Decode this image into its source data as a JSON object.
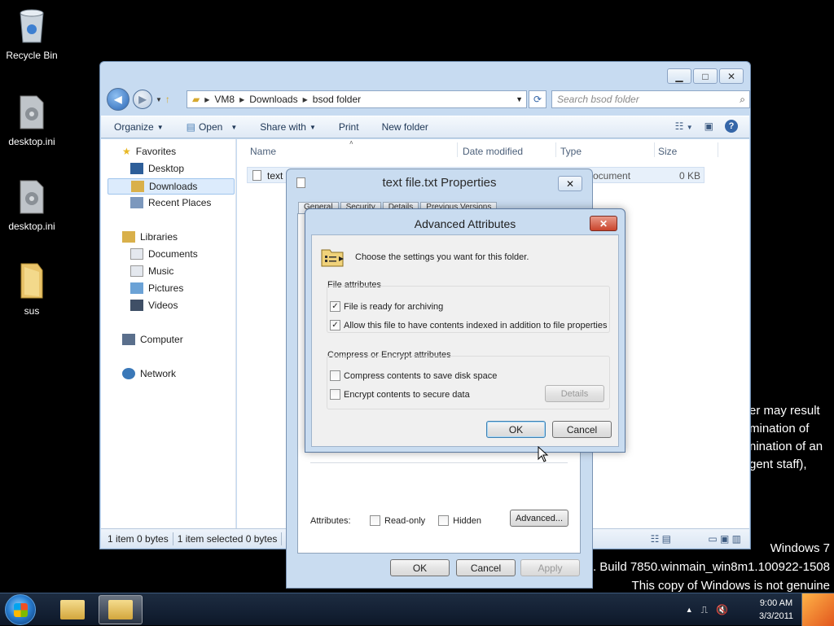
{
  "desktop": {
    "icons": [
      {
        "label": "Recycle Bin"
      },
      {
        "label": "desktop.ini"
      },
      {
        "label": "desktop.ini"
      },
      {
        "label": "sus"
      }
    ],
    "bg_text": [
      "er may result",
      "mination of",
      "nination of an",
      "gent staff),"
    ],
    "watermark": {
      "line1": "Windows 7",
      "line2": ". Build 7850.winmain_win8m1.100922-1508",
      "line3": "This copy of Windows is not genuine"
    }
  },
  "explorer": {
    "breadcrumb": [
      "VM8",
      "Downloads",
      "bsod folder"
    ],
    "search_placeholder": "Search bsod folder",
    "toolbar": {
      "organize": "Organize",
      "open": "Open",
      "share_with": "Share with",
      "print": "Print",
      "new_folder": "New folder"
    },
    "nav": {
      "favorites": "Favorites",
      "desktop": "Desktop",
      "downloads": "Downloads",
      "recent_places": "Recent Places",
      "libraries": "Libraries",
      "documents": "Documents",
      "music": "Music",
      "pictures": "Pictures",
      "videos": "Videos",
      "computer": "Computer",
      "network": "Network"
    },
    "columns": {
      "name": "Name",
      "date_modified": "Date modified",
      "type": "Type",
      "size": "Size"
    },
    "file": {
      "name": "text",
      "type": "ocument",
      "size": "0 KB"
    },
    "status": {
      "items": "1 item  0 bytes",
      "selected": "1 item selected  0 bytes"
    }
  },
  "properties": {
    "title": "text file.txt Properties",
    "tabs": [
      "General",
      "Security",
      "Details",
      "Previous Versions"
    ],
    "attributes_label": "Attributes:",
    "readonly_label": "Read-only",
    "hidden_label": "Hidden",
    "advanced_button": "Advanced...",
    "ok": "OK",
    "cancel": "Cancel",
    "apply": "Apply"
  },
  "advanced": {
    "title": "Advanced Attributes",
    "description": "Choose the settings you want for this folder.",
    "file_attributes_title": "File attributes",
    "archive_label": "File is ready for archiving",
    "archive_checked": true,
    "index_label": "Allow this file to have contents indexed in addition to file properties",
    "index_checked": true,
    "compress_title": "Compress or Encrypt attributes",
    "compress_label": "Compress contents to save disk space",
    "compress_checked": false,
    "encrypt_label": "Encrypt contents to secure data",
    "encrypt_checked": false,
    "details_button": "Details",
    "ok": "OK",
    "cancel": "Cancel"
  },
  "taskbar": {
    "clock_time": "9:00 AM",
    "clock_date": "3/3/2011"
  }
}
